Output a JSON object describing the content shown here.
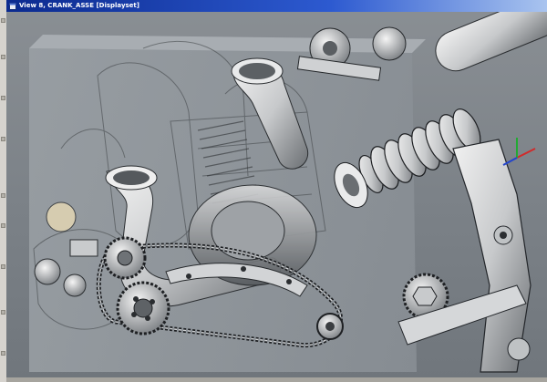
{
  "window": {
    "title": "View 8, CRANK_ASSE [Displayset]",
    "icon": "window-icon"
  },
  "viewport": {
    "content": "3d-cad-assembly-render",
    "background_color": "#7f858b",
    "part_color": "#d9dadb",
    "shadow_color": "#3a3d40",
    "title_bar_color": "#0b2a8f"
  },
  "toolbar": {
    "position": "left",
    "icon": "toolbar-icon"
  }
}
